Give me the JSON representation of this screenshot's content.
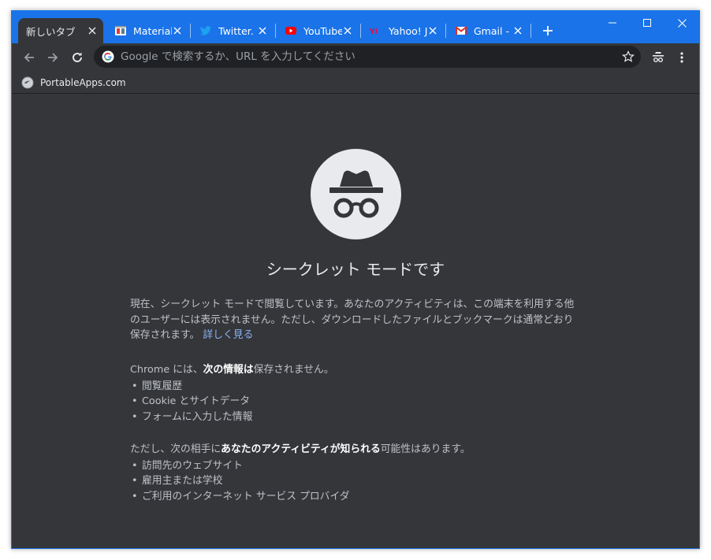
{
  "tabs": [
    {
      "title": "新しいタブ",
      "active": true,
      "favicon": "none"
    },
    {
      "title": "Material",
      "active": false,
      "favicon": "material-icon"
    },
    {
      "title": "Twitter.",
      "active": false,
      "favicon": "twitter-icon"
    },
    {
      "title": "YouTube",
      "active": false,
      "favicon": "youtube-icon"
    },
    {
      "title": "Yahoo! J",
      "active": false,
      "favicon": "yahoo-icon"
    },
    {
      "title": "Gmail - ",
      "active": false,
      "favicon": "gmail-icon"
    }
  ],
  "new_tab_label": "+",
  "window_controls": {
    "minimize": "—",
    "maximize": "☐",
    "close": "✕"
  },
  "omnibox": {
    "placeholder": "Google で検索するか、URL を入力してください",
    "value": ""
  },
  "bookmarks": [
    {
      "label": "PortableApps.com",
      "icon": "portableapps-icon"
    }
  ],
  "incognito": {
    "heading": "シークレット モードです",
    "para1_text": "現在、シークレット モードで閲覧しています。あなたのアクティビティは、この端末を利用する他のユーザーには表示されません。ただし、ダウンロードしたファイルとブックマークは通常どおり保存されます。",
    "learn_more": "詳しく見る",
    "not_saved_prefix": "Chrome には、",
    "not_saved_bold": "次の情報は",
    "not_saved_suffix": "保存されません。",
    "not_saved_items": [
      "閲覧履歴",
      "Cookie とサイトデータ",
      "フォームに入力した情報"
    ],
    "visible_prefix": "ただし、次の相手に",
    "visible_bold": "あなたのアクティビティが知られる",
    "visible_suffix": "可能性はあります。",
    "visible_items": [
      "訪問先のウェブサイト",
      "雇用主または学校",
      "ご利用のインターネット サービス プロバイダ"
    ]
  },
  "colors": {
    "accent": "#1a73e8",
    "background": "#35363a",
    "link": "#8ab4f8",
    "text": "#bdc1c6"
  }
}
